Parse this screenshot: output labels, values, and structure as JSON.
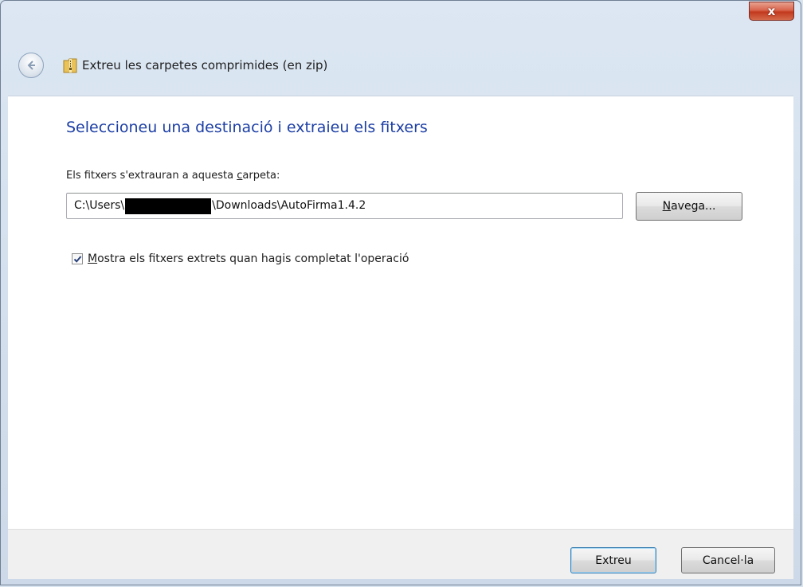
{
  "window": {
    "title": "Extreu les carpetes comprimides (en zip)",
    "close_glyph": "x"
  },
  "main": {
    "heading": "Seleccioneu una destinació i extraieu els fitxers",
    "folder_label_prefix": "Els fitxers s'extrauran a aquesta ",
    "folder_label_accel": "c",
    "folder_label_suffix": "arpeta:",
    "path_prefix": "C:\\Users\\",
    "path_suffix": "\\Downloads\\AutoFirma1.4.2",
    "browse_accel": "N",
    "browse_rest": "avega...",
    "checkbox_checked": true,
    "checkbox_accel": "M",
    "checkbox_rest": "ostra els fitxers extrets quan hagis completat l'operació"
  },
  "footer": {
    "extract_label": "Extreu",
    "cancel_label": "Cancel·la"
  },
  "icons": {
    "back": "back-arrow-icon",
    "zip": "zip-folder-icon",
    "check": "checkmark-icon"
  },
  "colors": {
    "heading": "#1d3fa5",
    "close_button": "#c2391e",
    "window_frame": "#dce7f3"
  }
}
